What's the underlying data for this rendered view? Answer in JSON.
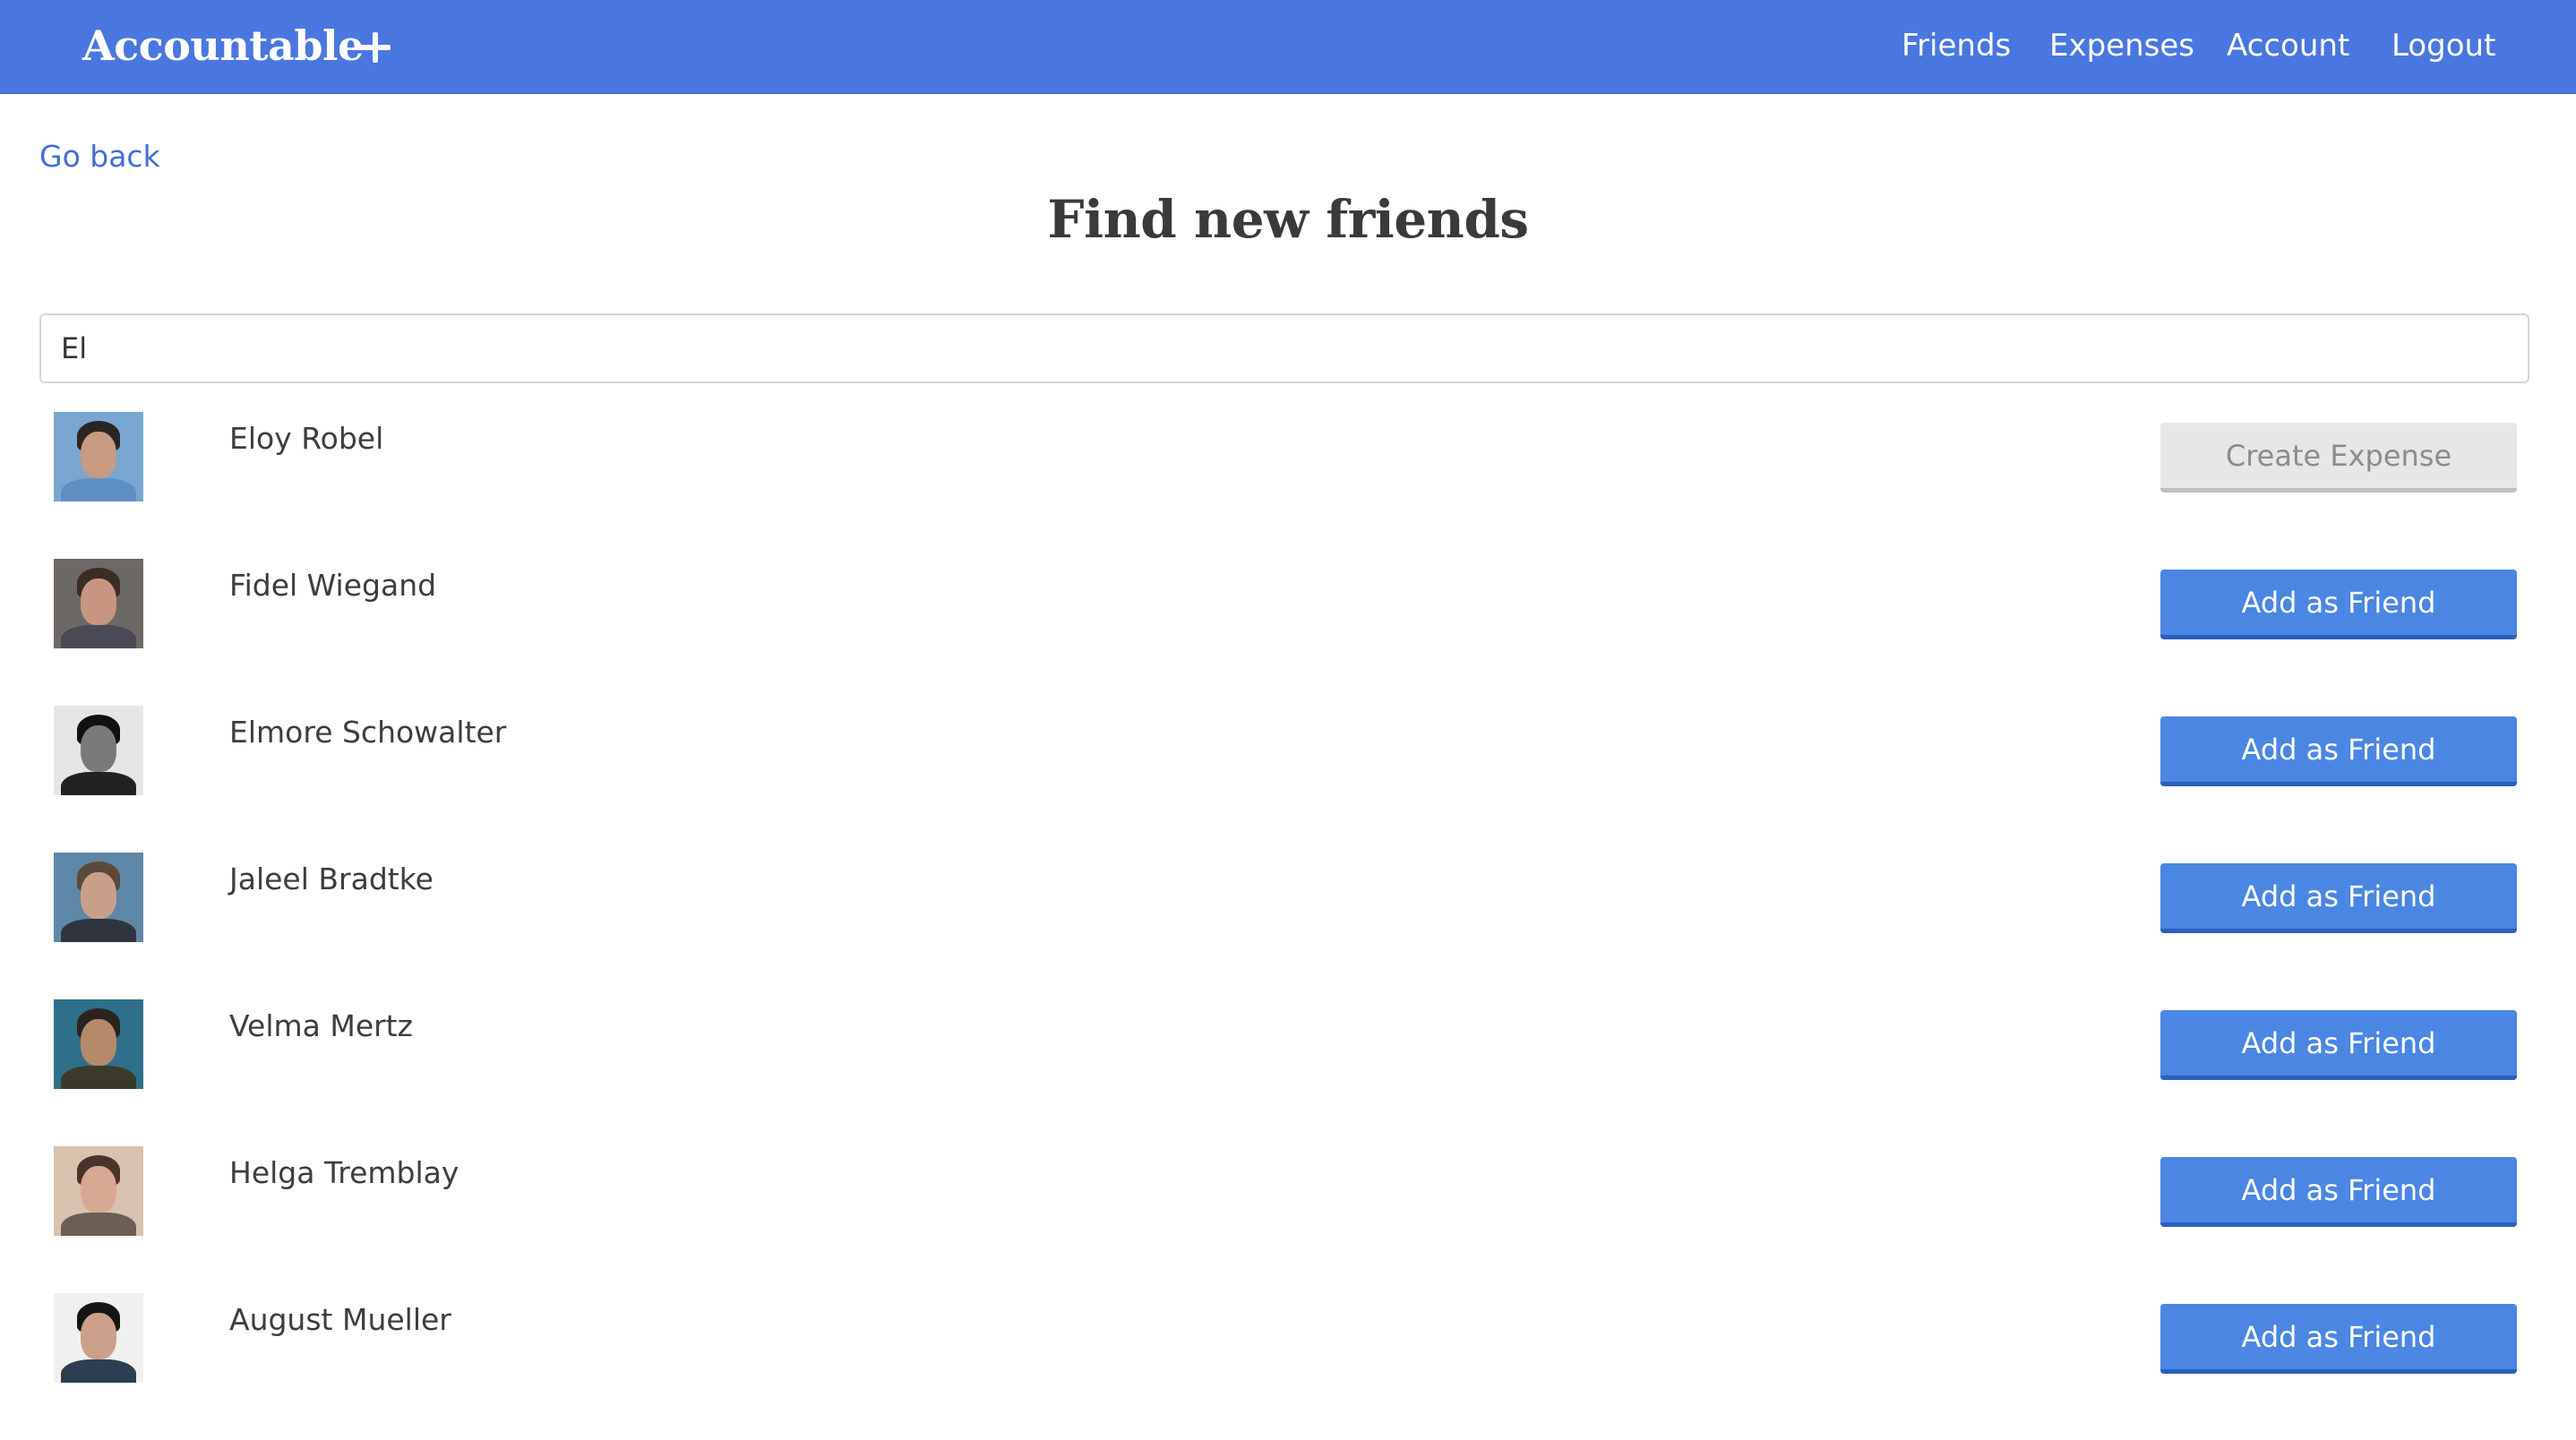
{
  "navbar": {
    "brand": "Accountable",
    "add_icon": "plus-icon",
    "links": [
      "Friends",
      "Expenses",
      "Account",
      "Logout"
    ]
  },
  "page": {
    "back_link": "Go back",
    "title": "Find new friends"
  },
  "search": {
    "value": "El",
    "placeholder": ""
  },
  "results": [
    {
      "name": "Eloy Robel",
      "action": "Create Expense",
      "action_style": "secondary",
      "avatar_colors": [
        "#7aa6cf",
        "#2a2523",
        "#c79a82",
        "#5e8fc2"
      ]
    },
    {
      "name": "Fidel Wiegand",
      "action": "Add as Friend",
      "action_style": "primary",
      "avatar_colors": [
        "#6b6866",
        "#3b2d25",
        "#c89580",
        "#4a4a55"
      ]
    },
    {
      "name": "Elmore Schowalter",
      "action": "Add as Friend",
      "action_style": "primary",
      "avatar_colors": [
        "#e6e6e6",
        "#111111",
        "#7a7a7a",
        "#222222"
      ]
    },
    {
      "name": "Jaleel Bradtke",
      "action": "Add as Friend",
      "action_style": "primary",
      "avatar_colors": [
        "#5f87a8",
        "#5b4a3c",
        "#c8a08a",
        "#2f3540"
      ]
    },
    {
      "name": "Velma Mertz",
      "action": "Add as Friend",
      "action_style": "primary",
      "avatar_colors": [
        "#2f6f8a",
        "#2a241f",
        "#b58a6a",
        "#3b3a2a"
      ]
    },
    {
      "name": "Helga Tremblay",
      "action": "Add as Friend",
      "action_style": "primary",
      "avatar_colors": [
        "#d9c2ae",
        "#4a3328",
        "#d8a893",
        "#6b5e55"
      ]
    },
    {
      "name": "August Mueller",
      "action": "Add as Friend",
      "action_style": "primary",
      "avatar_colors": [
        "#f0f0f0",
        "#151515",
        "#caa08a",
        "#2d3e52"
      ]
    }
  ]
}
